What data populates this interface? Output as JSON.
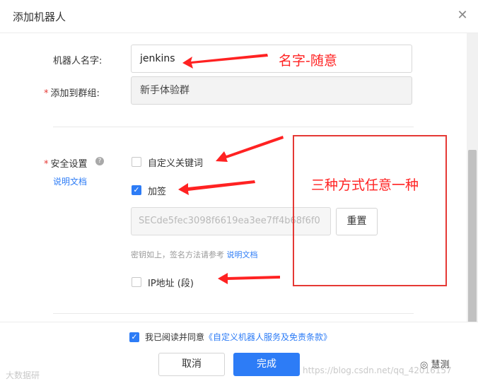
{
  "dialog": {
    "title": "添加机器人"
  },
  "form": {
    "name_label": "机器人名字:",
    "name_value": "jenkins",
    "group_label": "添加到群组:",
    "group_value": "新手体验群",
    "security_label": "安全设置",
    "security_doc_link": "说明文档",
    "options": [
      {
        "label": "自定义关键词",
        "checked": false
      },
      {
        "label": "加签",
        "checked": true
      },
      {
        "label": "IP地址 (段)",
        "checked": false
      }
    ],
    "secret_value": "SECde5fec3098f6619ea3ee7ff4b68f6f0",
    "reset_label": "重置",
    "hint_text": "密钥如上，签名方法请参考",
    "hint_link": "说明文档"
  },
  "footer": {
    "agree_text": "我已阅读并同意",
    "agree_link": "《自定义机器人服务及免责条款》",
    "cancel_label": "取消",
    "confirm_label": "完成"
  },
  "annotations": {
    "name_note": "名字-随意",
    "method_note": "三种方式任意一种"
  },
  "watermarks": {
    "left": "大数据研",
    "center": "https://blog.csdn.net/qq_42016157",
    "wechat": "慧测"
  },
  "colors": {
    "primary": "#2d7cf6",
    "annotation": "#e53935",
    "required": "#e53935"
  }
}
